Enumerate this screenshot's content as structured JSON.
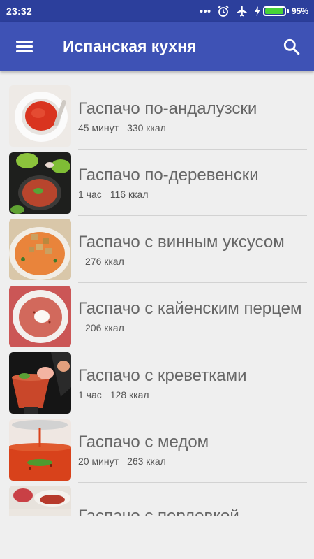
{
  "status_bar": {
    "time": "23:32",
    "icons": [
      "more-dots-icon",
      "alarm-clock-icon",
      "airplane-mode-icon",
      "charging-bolt-icon"
    ],
    "battery_percent": "95%",
    "battery_level": 0.95,
    "battery_color": "#47d337"
  },
  "app_bar": {
    "title": "Испанская кухня",
    "menu_icon": "hamburger-menu-icon",
    "search_icon": "search-icon",
    "color": "#3e52b5"
  },
  "recipes": [
    {
      "title": "Гаспачо по-андалузски",
      "time": "45 минут",
      "kcal": "330 ккал"
    },
    {
      "title": "Гаспачо по-деревенски",
      "time": "1 час",
      "kcal": "116 ккал"
    },
    {
      "title": "Гаспачо с винным уксусом",
      "time": "",
      "kcal": "276 ккал"
    },
    {
      "title": "Гаспачо с кайенским перцем",
      "time": "",
      "kcal": "206 ккал"
    },
    {
      "title": "Гаспачо с креветками",
      "time": "1 час",
      "kcal": "128 ккал"
    },
    {
      "title": "Гаспачо с медом",
      "time": "20 минут",
      "kcal": "263 ккал"
    },
    {
      "title": "Гаспачо с перловкой",
      "time": "",
      "kcal": ""
    }
  ]
}
